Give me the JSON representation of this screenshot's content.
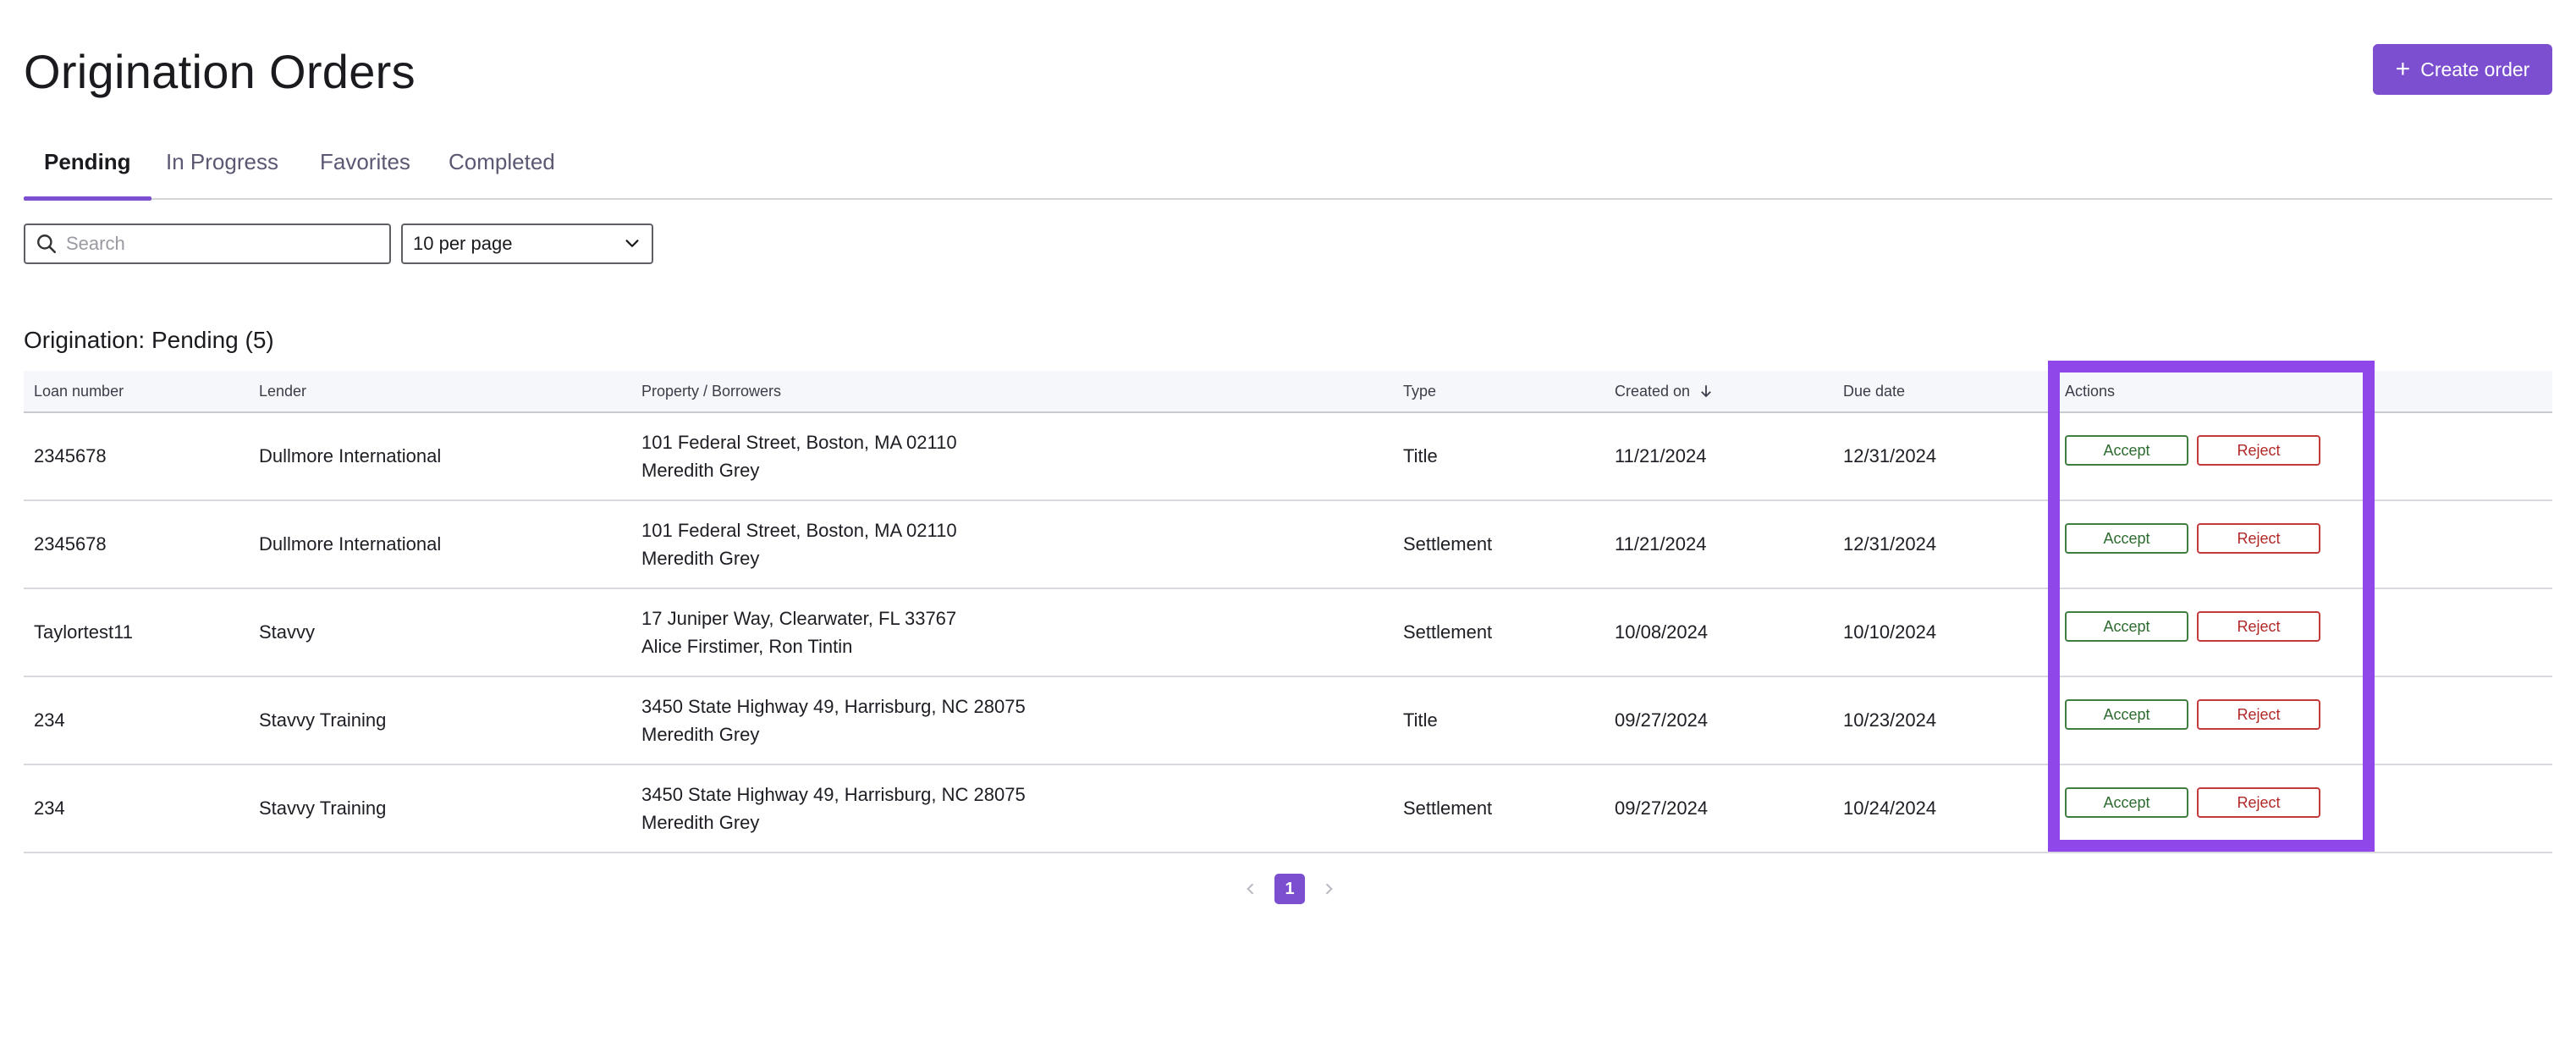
{
  "page": {
    "title": "Origination Orders",
    "create_button_label": "Create order"
  },
  "tabs": [
    {
      "label": "Pending",
      "active": true
    },
    {
      "label": "In Progress",
      "active": false
    },
    {
      "label": "Favorites",
      "active": false
    },
    {
      "label": "Completed",
      "active": false
    }
  ],
  "filters": {
    "search_placeholder": "Search",
    "per_page_value": "10 per page"
  },
  "section": {
    "title": "Origination: Pending (5)"
  },
  "table": {
    "headers": {
      "loan_number": "Loan number",
      "lender": "Lender",
      "property": "Property / Borrowers",
      "type": "Type",
      "created_on": "Created on",
      "due_date": "Due date",
      "actions": "Actions"
    },
    "accept_label": "Accept",
    "reject_label": "Reject",
    "rows": [
      {
        "loan": "2345678",
        "lender": "Dullmore International",
        "address": "101 Federal Street, Boston, MA 02110",
        "borrowers": "Meredith Grey",
        "type": "Title",
        "created": "11/21/2024",
        "due": "12/31/2024"
      },
      {
        "loan": "2345678",
        "lender": "Dullmore International",
        "address": "101 Federal Street, Boston, MA 02110",
        "borrowers": "Meredith Grey",
        "type": "Settlement",
        "created": "11/21/2024",
        "due": "12/31/2024"
      },
      {
        "loan": "Taylortest11",
        "lender": "Stavvy",
        "address": "17 Juniper Way, Clearwater, FL 33767",
        "borrowers": "Alice Firstimer, Ron Tintin",
        "type": "Settlement",
        "created": "10/08/2024",
        "due": "10/10/2024"
      },
      {
        "loan": "234",
        "lender": "Stavvy Training",
        "address": "3450 State Highway 49, Harrisburg, NC 28075",
        "borrowers": "Meredith Grey",
        "type": "Title",
        "created": "09/27/2024",
        "due": "10/23/2024"
      },
      {
        "loan": "234",
        "lender": "Stavvy Training",
        "address": "3450 State Highway 49, Harrisburg, NC 28075",
        "borrowers": "Meredith Grey",
        "type": "Settlement",
        "created": "09/27/2024",
        "due": "10/24/2024"
      }
    ]
  },
  "pagination": {
    "current_page": "1"
  },
  "colors": {
    "accent": "#7b4fcf",
    "highlight": "#9047ea",
    "accept": "#2e6b2e",
    "reject": "#b22727"
  },
  "icons": {
    "create": "plus-icon",
    "search": "search-icon",
    "dropdown": "chevron-down-icon",
    "sort": "arrow-down-icon",
    "prev": "chevron-left-icon",
    "next": "chevron-right-icon"
  }
}
